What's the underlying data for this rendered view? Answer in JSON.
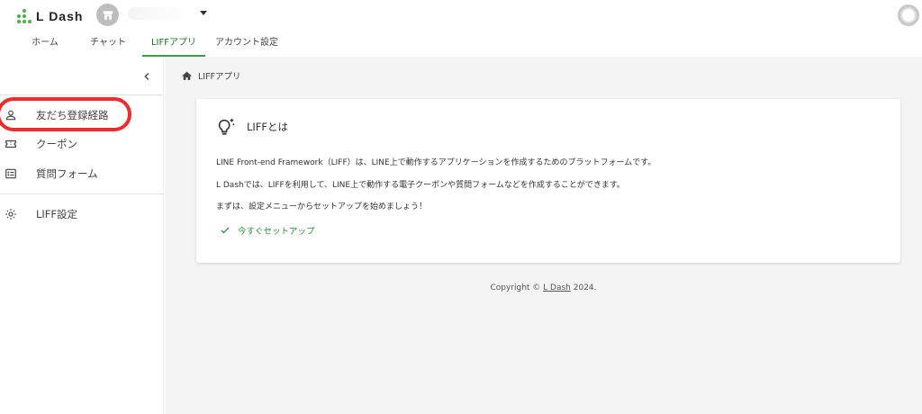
{
  "header": {
    "logo_text": "L Dash",
    "store_name": "",
    "tabs": [
      {
        "label": "ホーム"
      },
      {
        "label": "チャット"
      },
      {
        "label": "LIFFアプリ"
      },
      {
        "label": "アカウント設定"
      }
    ],
    "active_tab_index": 2
  },
  "sidebar": {
    "items": [
      {
        "label": "友だち登録経路",
        "icon": "person-add-icon"
      },
      {
        "label": "クーポン",
        "icon": "ticket-icon"
      },
      {
        "label": "質問フォーム",
        "icon": "form-icon"
      },
      {
        "label": "LIFF設定",
        "icon": "gear-icon"
      }
    ]
  },
  "breadcrumb": {
    "label": "LIFFアプリ",
    "icon": "home-icon"
  },
  "card": {
    "title": "LIFFとは",
    "icon": "lightbulb-icon",
    "paragraphs": [
      "LINE Front-end Framework（LIFF）は、LINE上で動作するアプリケーションを作成するためのプラットフォームです。",
      "L Dashでは、LIFFを利用して、LINE上で動作する電子クーポンや質問フォームなどを作成することができます。",
      "まずは、設定メニューからセットアップを始めましょう！"
    ],
    "setup_label": "今すぐセットアップ"
  },
  "footer": {
    "copyright_prefix": "Copyright © ",
    "copyright_link": "L Dash",
    "copyright_suffix": " 2024."
  },
  "colors": {
    "accent_green": "#3c9a4c",
    "highlight_red": "#ef2b2b",
    "main_bg": "#f4f4f4"
  }
}
